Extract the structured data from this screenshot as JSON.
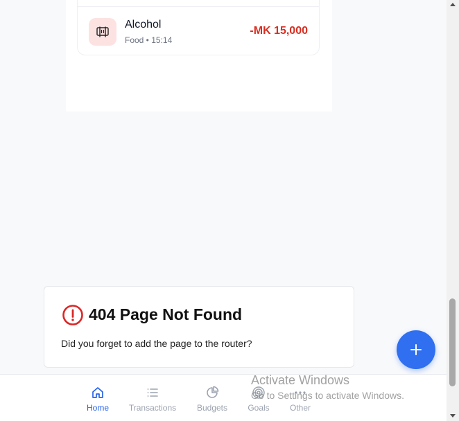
{
  "transaction": {
    "name": "Alcohol",
    "meta": "Food • 15:14",
    "amount": "-MK 15,000",
    "icon": "utensils-icon"
  },
  "error": {
    "title": "404 Page Not Found",
    "message": "Did you forget to add the page to the router?",
    "icon": "alert-circle-icon"
  },
  "fab": {
    "icon": "plus-icon"
  },
  "nav": {
    "items": [
      {
        "label": "Home",
        "icon": "home-icon",
        "active": true
      },
      {
        "label": "Transactions",
        "icon": "list-icon",
        "active": false
      },
      {
        "label": "Budgets",
        "icon": "pie-chart-icon",
        "active": false
      },
      {
        "label": "Goals",
        "icon": "target-icon",
        "active": false
      },
      {
        "label": "Other",
        "icon": "more-icon",
        "active": false
      }
    ]
  },
  "watermark": {
    "title": "Activate Windows",
    "subtitle": "Go to Settings to activate Windows."
  },
  "colors": {
    "accent": "#2f6ff0",
    "negative": "#d92d20",
    "error_icon": "#dc2626"
  }
}
